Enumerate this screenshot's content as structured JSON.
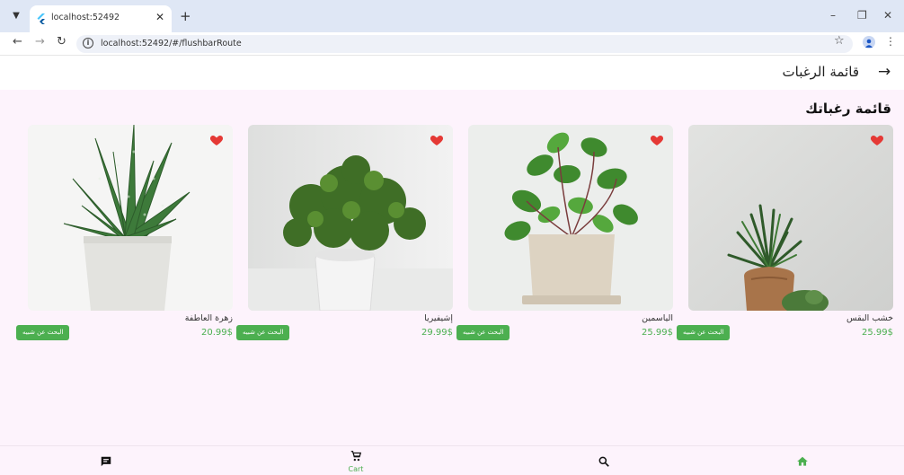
{
  "browser": {
    "tab_title": "localhost:52492",
    "url": "localhost:52492/#/flushbarRoute"
  },
  "appbar": {
    "title": "قائمة الرغبات"
  },
  "section": {
    "title": "قائمة رغباتك"
  },
  "products": [
    {
      "name": "خشب البقس",
      "price": "25.99$",
      "button": "البحث عن شبيه"
    },
    {
      "name": "الياسمين",
      "price": "25.99$",
      "button": "البحث عن شبيه"
    },
    {
      "name": "إشيفيريا",
      "price": "29.99$",
      "button": "البحث عن شبيه"
    },
    {
      "name": "زهرة العاطفة",
      "price": "20.99$",
      "button": "البحث عن شبيه"
    }
  ],
  "bottom_nav": {
    "items": [
      {
        "icon": "home-icon",
        "label": ""
      },
      {
        "icon": "search-icon",
        "label": ""
      },
      {
        "icon": "cart-icon",
        "label": "Cart"
      },
      {
        "icon": "chat-icon",
        "label": ""
      }
    ]
  },
  "colors": {
    "accent": "#4caf50",
    "heart": "#e53935",
    "page_bg": "#fdf3fc"
  }
}
